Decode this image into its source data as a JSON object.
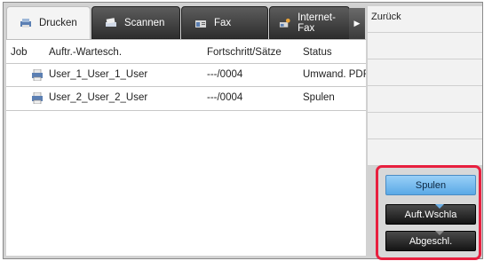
{
  "tabs": [
    {
      "label": "Drucken",
      "icon": "printer-icon",
      "active": true
    },
    {
      "label": "Scannen",
      "icon": "scanner-icon",
      "active": false
    },
    {
      "label": "Fax",
      "icon": "fax-icon",
      "active": false
    },
    {
      "label": "Internet-Fax",
      "icon": "internet-fax-icon",
      "active": false
    }
  ],
  "tab_scroll_icon": "right-arrow-icon",
  "table": {
    "headers": {
      "job": "Job",
      "queue": "Auftr.-Wartesch.",
      "progress": "Fortschritt/Sätze",
      "status": "Status"
    },
    "rows": [
      {
        "name": "User_1_User_1_User",
        "progress": "---/0004",
        "status": "Umwand. PDF"
      },
      {
        "name": "User_2_User_2_User",
        "progress": "---/0004",
        "status": "Spulen"
      }
    ]
  },
  "side_panel": {
    "back_label": "Zurück"
  },
  "queue_buttons": {
    "spool": "Spulen",
    "job_queue": "Auft.Wschla",
    "complete": "Abgeschl."
  },
  "colors": {
    "highlight": "#e8203f",
    "selected_button": "#5aa9e6"
  }
}
